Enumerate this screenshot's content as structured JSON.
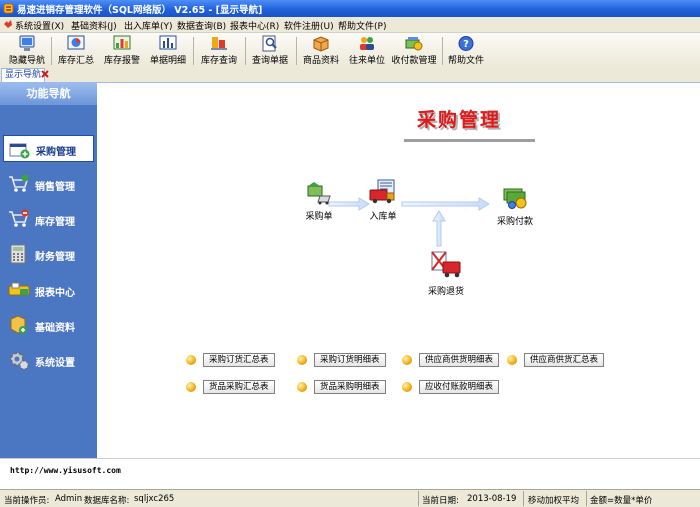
{
  "window": {
    "title": "易速进销存管理软件（SQL网络版） V2.65 - [显示导航]"
  },
  "menu": [
    "系统设置(X)",
    "基础资料(J)",
    "出入库单(Y)",
    "数据查询(B)",
    "报表中心(R)",
    "软件注册(U)",
    "帮助文件(P)"
  ],
  "toolbar": [
    {
      "label": "隐藏导航",
      "icon": "monitor-icon"
    },
    {
      "label": "库存汇总",
      "icon": "pie-chart-icon"
    },
    {
      "label": "库存报警",
      "icon": "warning-chart-icon"
    },
    {
      "label": "单据明细",
      "icon": "bar-chart-icon"
    },
    {
      "label": "库存查询",
      "icon": "stock-query-icon"
    },
    {
      "label": "查询单据",
      "icon": "search-document-icon"
    },
    {
      "label": "商品资料",
      "icon": "product-box-icon"
    },
    {
      "label": "往来单位",
      "icon": "partner-units-icon"
    },
    {
      "label": "收付款管理",
      "icon": "payment-icon"
    },
    {
      "label": "帮助文件",
      "icon": "help-icon"
    }
  ],
  "tab": {
    "label": "显示导航"
  },
  "sidebar": {
    "header": "功能导航",
    "items": [
      {
        "label": "采购管理",
        "icon": "purchase-icon",
        "active": true
      },
      {
        "label": "销售管理",
        "icon": "sales-cart-icon",
        "active": false
      },
      {
        "label": "库存管理",
        "icon": "inventory-cart-icon",
        "active": false
      },
      {
        "label": "财务管理",
        "icon": "calculator-icon",
        "active": false
      },
      {
        "label": "报表中心",
        "icon": "report-icon",
        "active": false
      },
      {
        "label": "基础资料",
        "icon": "basic-data-icon",
        "active": false
      },
      {
        "label": "系统设置",
        "icon": "settings-gear-icon",
        "active": false
      }
    ]
  },
  "main": {
    "title": "采购管理",
    "flow": [
      {
        "label": "采购单",
        "icon": "purchase-order-icon"
      },
      {
        "label": "入库单",
        "icon": "stock-in-truck-icon"
      },
      {
        "label": "采购付款",
        "icon": "purchase-payment-icon"
      },
      {
        "label": "采购退货",
        "icon": "purchase-return-icon"
      }
    ],
    "links": [
      "采购订货汇总表",
      "采购订货明细表",
      "供应商供货明细表",
      "供应商供货汇总表",
      "货品采购汇总表",
      "货品采购明细表",
      "应收付账款明细表"
    ]
  },
  "url": "http://www.yisusoft.com",
  "status": {
    "operator_label": "当前操作员:",
    "operator": "Admin",
    "db_label": "数据库名称:",
    "db": "sqljxc265",
    "date_label": "当前日期:",
    "date": "2013-08-19",
    "cost_method": "移动加权平均",
    "amount_formula": "金额=数量*单价"
  },
  "colors": {
    "sidebar": "#4b76c2",
    "title_red": "#e01a1a",
    "titlebar": "#1f5fd8"
  }
}
